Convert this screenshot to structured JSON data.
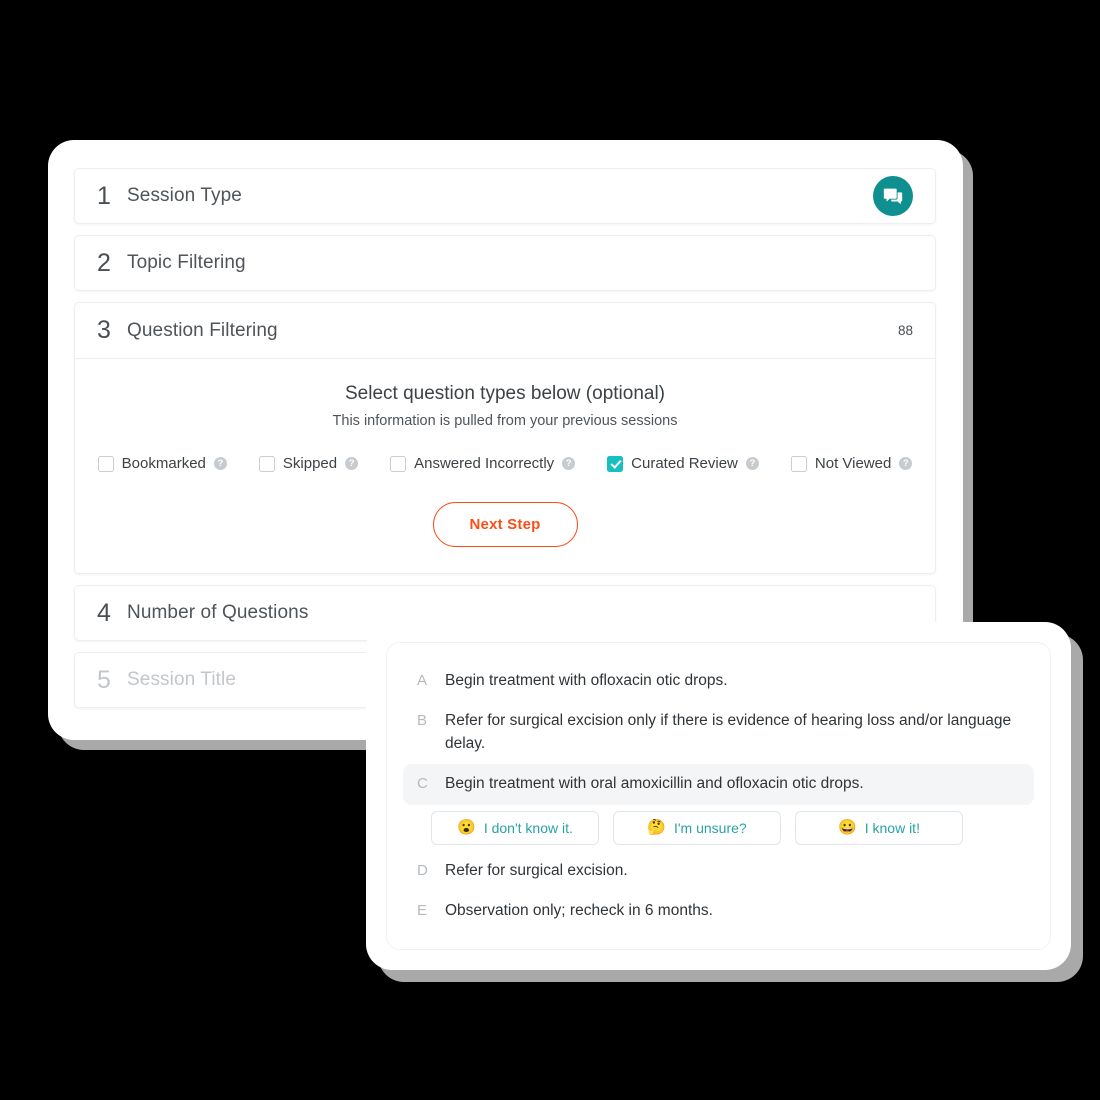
{
  "wizard": {
    "steps": [
      {
        "number": "1",
        "label": "Session Type",
        "state": "collapsed",
        "trailing": "chat-fab"
      },
      {
        "number": "2",
        "label": "Topic Filtering",
        "state": "collapsed",
        "trailing": "none"
      },
      {
        "number": "3",
        "label": "Question Filtering",
        "state": "expanded",
        "count": "88"
      },
      {
        "number": "4",
        "label": "Number of Questions",
        "state": "collapsed",
        "trailing": "none"
      },
      {
        "number": "5",
        "label": "Session Title",
        "state": "disabled",
        "trailing": "none"
      }
    ]
  },
  "question_filtering": {
    "title": "Select question types below (optional)",
    "subtitle": "This information is pulled from your previous sessions",
    "count_badge": "88",
    "filters": [
      {
        "label": "Bookmarked",
        "checked": false,
        "help": "?"
      },
      {
        "label": "Skipped",
        "checked": false,
        "help": "?"
      },
      {
        "label": "Answered Incorrectly",
        "checked": false,
        "help": "?"
      },
      {
        "label": "Curated Review",
        "checked": true,
        "help": "?"
      },
      {
        "label": "Not Viewed",
        "checked": false,
        "help": "?"
      }
    ],
    "next_button": "Next Step"
  },
  "question_card": {
    "answers": [
      {
        "letter": "A",
        "text": "Begin treatment with ofloxacin otic drops.",
        "highlighted": false
      },
      {
        "letter": "B",
        "text": "Refer for surgical excision only if there is evidence of hearing loss and/or language delay.",
        "highlighted": false
      },
      {
        "letter": "C",
        "text": "Begin treatment with oral amoxicillin and ofloxacin otic drops.",
        "highlighted": true
      },
      {
        "letter": "D",
        "text": "Refer for surgical excision.",
        "highlighted": false
      },
      {
        "letter": "E",
        "text": "Observation only; recheck in 6 months.",
        "highlighted": false
      }
    ],
    "confidence_buttons": [
      {
        "emoji": "😮",
        "emoji_name": "face-with-open-mouth",
        "label": "I don't know it."
      },
      {
        "emoji": "🤔",
        "emoji_name": "thinking-face",
        "label": "I'm unsure?"
      },
      {
        "emoji": "😀",
        "emoji_name": "grinning-face",
        "label": "I know it!"
      }
    ]
  },
  "colors": {
    "teal_accent": "#0f8f8f",
    "checkbox_checked": "#18bfbf",
    "next_button_orange": "#f84f19",
    "confidence_text_teal": "#2aa3a8",
    "shadow_gray": "#a9a9a9",
    "page_background": "#000000"
  },
  "icons": {
    "chat_fab": "forum-icon"
  }
}
